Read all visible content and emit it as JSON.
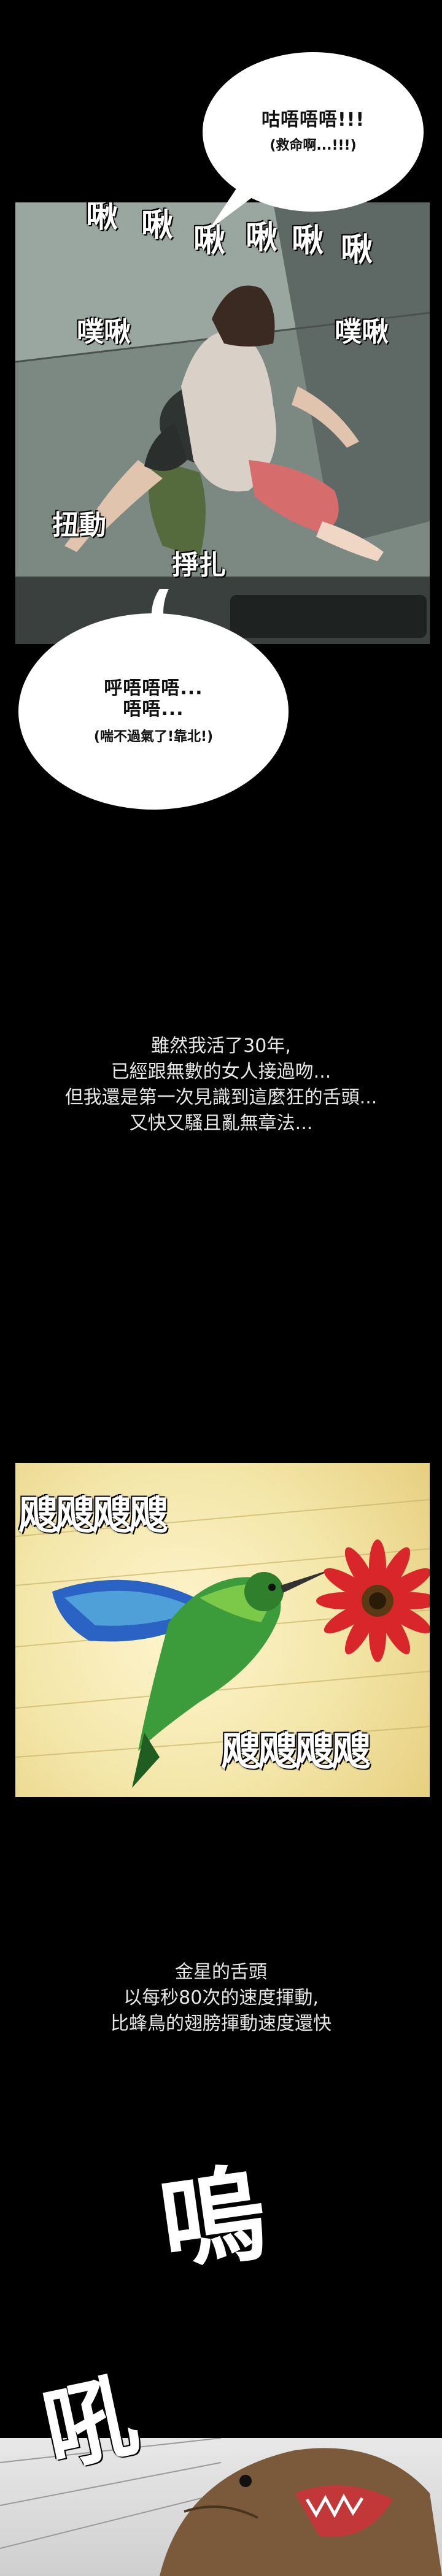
{
  "bubble_top": {
    "line1": "咕唔唔唔!!!",
    "line2": "(救命啊...!!!)"
  },
  "panel1_sfx": {
    "s1": "啾",
    "s2": "啾",
    "s3": "啾",
    "s4": "啾",
    "s5": "啾",
    "s6": "啾",
    "left": "噗啾",
    "right": "噗啾",
    "twist": "扭動",
    "struggle": "掙扎"
  },
  "bubble_mid": {
    "line1": "呼唔唔唔...",
    "line2": "唔唔...",
    "line3": "(喘不過氣了!靠北!)"
  },
  "caption1": {
    "line1": "雖然我活了30年,",
    "line2": "已經跟無數的女人接過吻...",
    "line3": "但我還是第一次見識到這麼狂的舌頭...",
    "line4": "又快又騷且亂無章法..."
  },
  "panel2_sfx": {
    "top": "飕飕飕飕",
    "bottom": "飕飕飕飕"
  },
  "caption2": {
    "line1": "金星的舌頭",
    "line2": "以每秒80次的速度揮動,",
    "line3": "比蜂鳥的翅膀揮動速度還快"
  },
  "panel3_sfx": {
    "a": "吼",
    "b": "嗚"
  },
  "colors": {
    "background": "#000000",
    "bubble": "#ffffff",
    "caption": "#e8e8e8",
    "panel2_bg": "#f3e6a8"
  }
}
